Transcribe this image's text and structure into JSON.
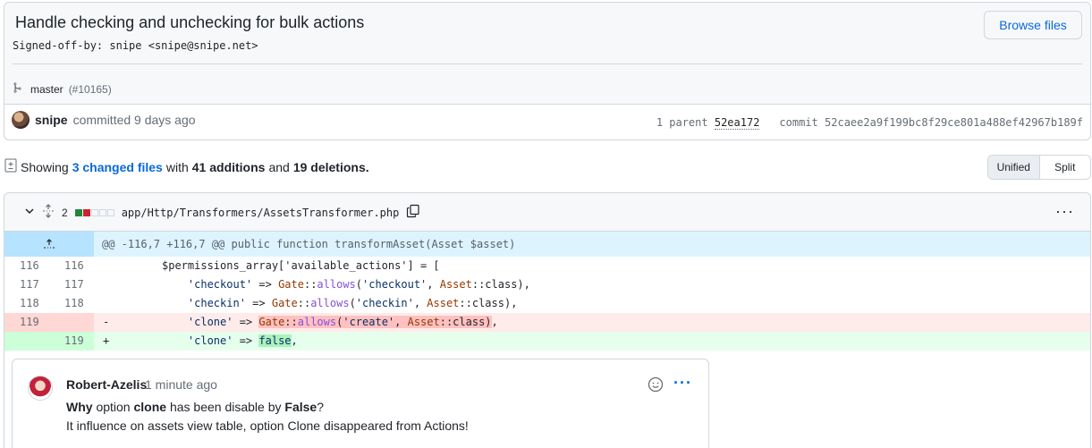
{
  "commit": {
    "title": "Handle checking and unchecking for bulk actions",
    "description": "Signed-off-by: snipe <snipe@snipe.net>",
    "browse_label": "Browse files",
    "branch": "master",
    "pr_ref": "(#10165)",
    "author": "snipe",
    "committed_text": "committed 9 days ago",
    "parent_label": "1 parent",
    "parent_hash": "52ea172",
    "commit_label": "commit",
    "commit_hash": "52caee2a9f199bc8f29ce801a488ef42967b189f"
  },
  "summary": {
    "showing": "Showing",
    "changed_files": "3 changed files",
    "with": "with",
    "additions": "41 additions",
    "and": "and",
    "deletions": "19 deletions."
  },
  "view_toggle": {
    "unified": "Unified",
    "split": "Split",
    "active": "Unified"
  },
  "file": {
    "change_count": "2",
    "path": "app/Http/Transformers/AssetsTransformer.php",
    "hunk_header": "@@ -116,7 +116,7 @@ public function transformAsset(Asset $asset)"
  },
  "lines": [
    {
      "old": "116",
      "new": "116",
      "sign": "",
      "code": "$permissions_array['available_actions'] = ["
    },
    {
      "old": "117",
      "new": "117",
      "sign": "",
      "code": "    'checkout' => Gate::allows('checkout', Asset::class),"
    },
    {
      "old": "118",
      "new": "118",
      "sign": "",
      "code": "    'checkin' => Gate::allows('checkin', Asset::class),"
    },
    {
      "old": "119",
      "new": "",
      "sign": "-",
      "code": "    'clone' => Gate::allows('create', Asset::class),"
    },
    {
      "old": "",
      "new": "119",
      "sign": "+",
      "code": "    'clone' => false,"
    }
  ],
  "comment": {
    "author": "Robert-Azelis",
    "time": "1 minute ago",
    "line1_a": "Why",
    "line1_b": "option",
    "line1_c": "clone",
    "line1_d": "has been disable by",
    "line1_e": "False",
    "line1_f": "?",
    "line2": "It influence on assets view table, option Clone disappeared from Actions!"
  },
  "colors": {
    "link": "#0969da",
    "deletion_bg": "#ffebe9",
    "addition_bg": "#e6ffec",
    "hunk_bg": "#ddf4ff"
  },
  "icons": [
    "branch-icon",
    "file-diff-icon",
    "chevron-down-icon",
    "expand-icon",
    "copy-icon",
    "kebab-icon",
    "smiley-icon"
  ]
}
